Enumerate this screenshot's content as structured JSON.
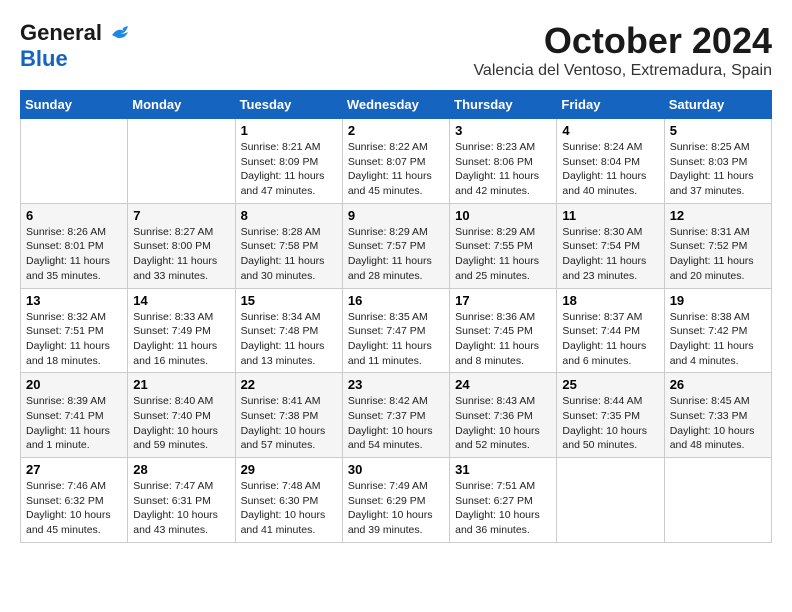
{
  "logo": {
    "line1": "General",
    "line2": "Blue"
  },
  "title": {
    "month": "October 2024",
    "location": "Valencia del Ventoso, Extremadura, Spain"
  },
  "weekdays": [
    "Sunday",
    "Monday",
    "Tuesday",
    "Wednesday",
    "Thursday",
    "Friday",
    "Saturday"
  ],
  "weeks": [
    [
      {
        "day": null,
        "info": null
      },
      {
        "day": null,
        "info": null
      },
      {
        "day": "1",
        "info": "Sunrise: 8:21 AM\nSunset: 8:09 PM\nDaylight: 11 hours and 47 minutes."
      },
      {
        "day": "2",
        "info": "Sunrise: 8:22 AM\nSunset: 8:07 PM\nDaylight: 11 hours and 45 minutes."
      },
      {
        "day": "3",
        "info": "Sunrise: 8:23 AM\nSunset: 8:06 PM\nDaylight: 11 hours and 42 minutes."
      },
      {
        "day": "4",
        "info": "Sunrise: 8:24 AM\nSunset: 8:04 PM\nDaylight: 11 hours and 40 minutes."
      },
      {
        "day": "5",
        "info": "Sunrise: 8:25 AM\nSunset: 8:03 PM\nDaylight: 11 hours and 37 minutes."
      }
    ],
    [
      {
        "day": "6",
        "info": "Sunrise: 8:26 AM\nSunset: 8:01 PM\nDaylight: 11 hours and 35 minutes."
      },
      {
        "day": "7",
        "info": "Sunrise: 8:27 AM\nSunset: 8:00 PM\nDaylight: 11 hours and 33 minutes."
      },
      {
        "day": "8",
        "info": "Sunrise: 8:28 AM\nSunset: 7:58 PM\nDaylight: 11 hours and 30 minutes."
      },
      {
        "day": "9",
        "info": "Sunrise: 8:29 AM\nSunset: 7:57 PM\nDaylight: 11 hours and 28 minutes."
      },
      {
        "day": "10",
        "info": "Sunrise: 8:29 AM\nSunset: 7:55 PM\nDaylight: 11 hours and 25 minutes."
      },
      {
        "day": "11",
        "info": "Sunrise: 8:30 AM\nSunset: 7:54 PM\nDaylight: 11 hours and 23 minutes."
      },
      {
        "day": "12",
        "info": "Sunrise: 8:31 AM\nSunset: 7:52 PM\nDaylight: 11 hours and 20 minutes."
      }
    ],
    [
      {
        "day": "13",
        "info": "Sunrise: 8:32 AM\nSunset: 7:51 PM\nDaylight: 11 hours and 18 minutes."
      },
      {
        "day": "14",
        "info": "Sunrise: 8:33 AM\nSunset: 7:49 PM\nDaylight: 11 hours and 16 minutes."
      },
      {
        "day": "15",
        "info": "Sunrise: 8:34 AM\nSunset: 7:48 PM\nDaylight: 11 hours and 13 minutes."
      },
      {
        "day": "16",
        "info": "Sunrise: 8:35 AM\nSunset: 7:47 PM\nDaylight: 11 hours and 11 minutes."
      },
      {
        "day": "17",
        "info": "Sunrise: 8:36 AM\nSunset: 7:45 PM\nDaylight: 11 hours and 8 minutes."
      },
      {
        "day": "18",
        "info": "Sunrise: 8:37 AM\nSunset: 7:44 PM\nDaylight: 11 hours and 6 minutes."
      },
      {
        "day": "19",
        "info": "Sunrise: 8:38 AM\nSunset: 7:42 PM\nDaylight: 11 hours and 4 minutes."
      }
    ],
    [
      {
        "day": "20",
        "info": "Sunrise: 8:39 AM\nSunset: 7:41 PM\nDaylight: 11 hours and 1 minute."
      },
      {
        "day": "21",
        "info": "Sunrise: 8:40 AM\nSunset: 7:40 PM\nDaylight: 10 hours and 59 minutes."
      },
      {
        "day": "22",
        "info": "Sunrise: 8:41 AM\nSunset: 7:38 PM\nDaylight: 10 hours and 57 minutes."
      },
      {
        "day": "23",
        "info": "Sunrise: 8:42 AM\nSunset: 7:37 PM\nDaylight: 10 hours and 54 minutes."
      },
      {
        "day": "24",
        "info": "Sunrise: 8:43 AM\nSunset: 7:36 PM\nDaylight: 10 hours and 52 minutes."
      },
      {
        "day": "25",
        "info": "Sunrise: 8:44 AM\nSunset: 7:35 PM\nDaylight: 10 hours and 50 minutes."
      },
      {
        "day": "26",
        "info": "Sunrise: 8:45 AM\nSunset: 7:33 PM\nDaylight: 10 hours and 48 minutes."
      }
    ],
    [
      {
        "day": "27",
        "info": "Sunrise: 7:46 AM\nSunset: 6:32 PM\nDaylight: 10 hours and 45 minutes."
      },
      {
        "day": "28",
        "info": "Sunrise: 7:47 AM\nSunset: 6:31 PM\nDaylight: 10 hours and 43 minutes."
      },
      {
        "day": "29",
        "info": "Sunrise: 7:48 AM\nSunset: 6:30 PM\nDaylight: 10 hours and 41 minutes."
      },
      {
        "day": "30",
        "info": "Sunrise: 7:49 AM\nSunset: 6:29 PM\nDaylight: 10 hours and 39 minutes."
      },
      {
        "day": "31",
        "info": "Sunrise: 7:51 AM\nSunset: 6:27 PM\nDaylight: 10 hours and 36 minutes."
      },
      {
        "day": null,
        "info": null
      },
      {
        "day": null,
        "info": null
      }
    ]
  ]
}
